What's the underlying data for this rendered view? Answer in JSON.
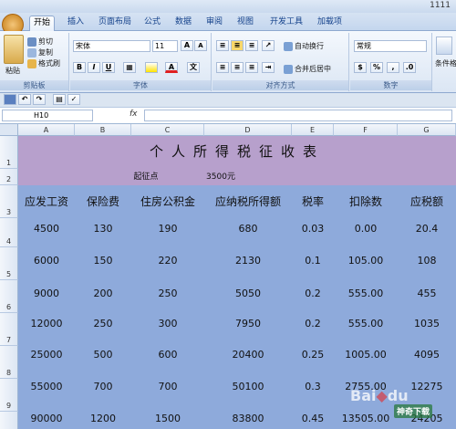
{
  "window": {
    "title": "1111"
  },
  "tabs": [
    "开始",
    "插入",
    "页面布局",
    "公式",
    "数据",
    "审阅",
    "视图",
    "开发工具",
    "加载项"
  ],
  "ribbon": {
    "clipboard": {
      "label": "剪贴板",
      "paste": "粘贴",
      "cut": "剪切",
      "copy": "复制",
      "format_painter": "格式刷"
    },
    "font": {
      "label": "字体",
      "font_name": "宋体",
      "font_size": "11",
      "bold": "B",
      "italic": "I",
      "underline": "U"
    },
    "alignment": {
      "label": "对齐方式",
      "wrap_text": "自动换行",
      "merge_center": "合并后居中"
    },
    "number": {
      "label": "数字",
      "format": "常规"
    },
    "more": {
      "label": "条件格"
    }
  },
  "formula_bar": {
    "name_box": "H10",
    "fx": "fx"
  },
  "sheet": {
    "columns": [
      "A",
      "B",
      "C",
      "D",
      "E",
      "F",
      "G"
    ],
    "rows": [
      "1",
      "2",
      "3",
      "4",
      "5",
      "6",
      "7",
      "8",
      "9",
      "10"
    ],
    "title": "个人所得税征收表",
    "threshold_label": "起征点",
    "threshold_value": "3500元",
    "headers": [
      "应发工资",
      "保险费",
      "住房公积金",
      "应纳税所得额",
      "税率",
      "扣除数",
      "应税额"
    ],
    "data": [
      [
        "4500",
        "130",
        "190",
        "680",
        "0.03",
        "0.00",
        "20.4"
      ],
      [
        "6000",
        "150",
        "220",
        "2130",
        "0.1",
        "105.00",
        "108"
      ],
      [
        "9000",
        "200",
        "250",
        "5050",
        "0.2",
        "555.00",
        "455"
      ],
      [
        "12000",
        "250",
        "300",
        "7950",
        "0.2",
        "555.00",
        "1035"
      ],
      [
        "25000",
        "500",
        "600",
        "20400",
        "0.25",
        "1005.00",
        "4095"
      ],
      [
        "55000",
        "700",
        "700",
        "50100",
        "0.3",
        "2755.00",
        "12275"
      ],
      [
        "90000",
        "1200",
        "1500",
        "83800",
        "0.45",
        "13505.00",
        "24205"
      ]
    ]
  },
  "colors": {
    "title_bg": "#b7a0cc",
    "table_bg": "#8eaadb",
    "header_bg": "#dbe5f1"
  },
  "watermark": {
    "text1": "Bai",
    "text2": "du",
    "text3": "神奇下载"
  }
}
